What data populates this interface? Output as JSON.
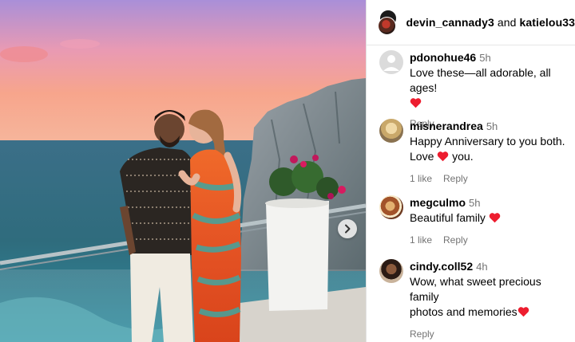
{
  "post": {
    "header": {
      "user1": "devin_cannady3",
      "conjunction": "and",
      "user2": "katielou33"
    },
    "photo": {
      "description_icon": "chevron-right-icon"
    }
  },
  "comments": [
    {
      "username": "pdonohue46",
      "time": "5h",
      "text": "Love these—all adorable, all ages!",
      "hearts": 1,
      "heart_inline": false,
      "likes": "",
      "reply": "Reply",
      "avatar": "default-avatar-icon"
    },
    {
      "username": "misnerandrea",
      "time": "5h",
      "text_a": "Happy Anniversary to you both. Love",
      "text_b": "you.",
      "likes": "1 like",
      "reply": "Reply",
      "avatar": "user-avatar"
    },
    {
      "username": "megculmo",
      "time": "5h",
      "text": "Beautiful family",
      "likes": "1 like",
      "reply": "Reply",
      "avatar": "user-avatar"
    },
    {
      "username": "cindy.coll52",
      "time": "4h",
      "text_a": "Wow, what sweet precious family",
      "text_b": "photos and memories",
      "likes": "",
      "reply": "Reply",
      "avatar": "user-avatar"
    }
  ],
  "colors": {
    "heart": "#ed1d2f",
    "muted": "#737373",
    "divider": "#e6e6e6"
  }
}
